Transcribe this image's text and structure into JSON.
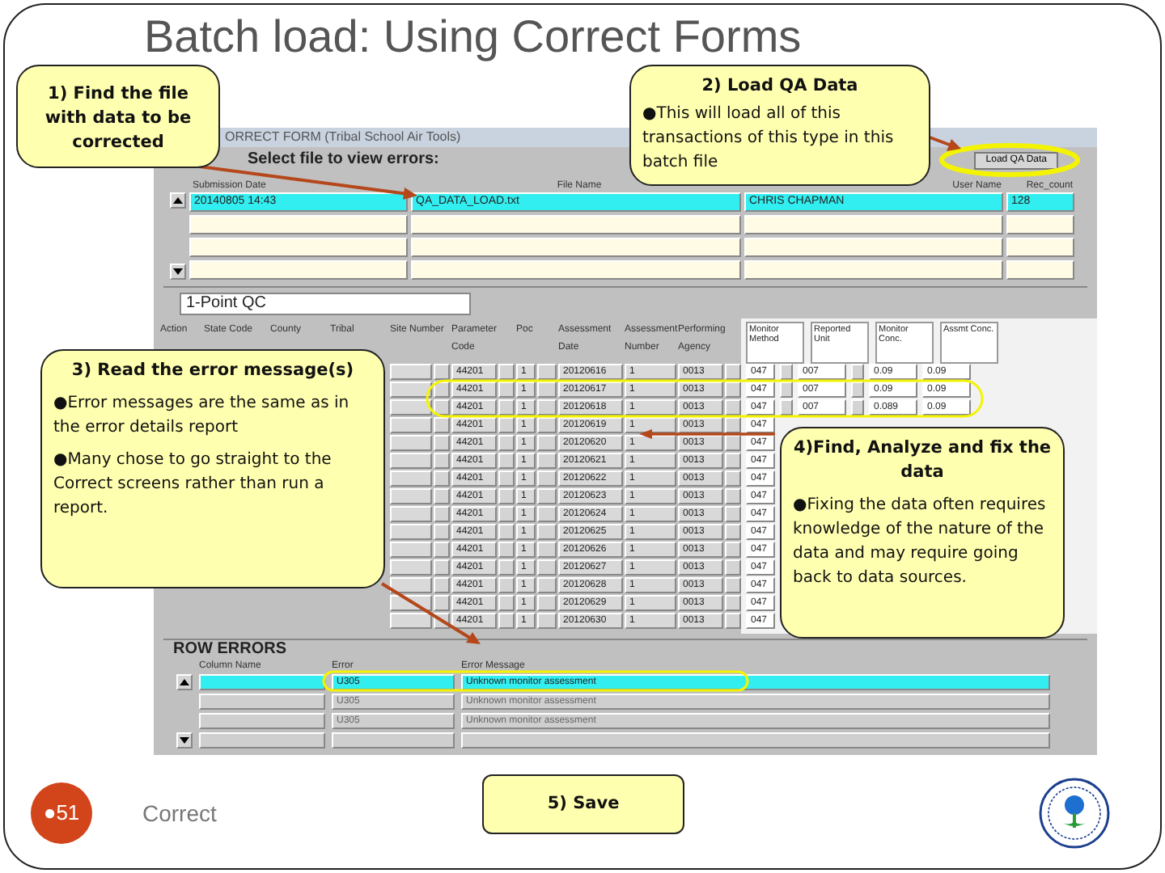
{
  "slide": {
    "title": "Batch load: Using Correct Forms",
    "footer_text": "Correct",
    "slide_number": "●51"
  },
  "form": {
    "title": "ORRECT FORM (Tribal School Air Tools)",
    "file_prompt": "Select file to view errors:",
    "load_button": "Load QA Data",
    "file_columns": [
      "Submission Date",
      "File Name",
      "User Name",
      "Rec_count"
    ],
    "files": [
      {
        "selected": true,
        "date": "20140805 14:43",
        "file": "QA_DATA_LOAD.txt",
        "user": "CHRIS CHAPMAN",
        "count": "128"
      },
      {
        "selected": false
      },
      {
        "selected": false
      },
      {
        "selected": false
      }
    ],
    "transaction_type": "1-Point QC",
    "qc_columns": [
      "Action",
      "State Code",
      "County",
      "Tribal",
      "Site Number",
      "Parameter Code",
      "Poc",
      "Assessment Date",
      "Assessment Number",
      "Performing Agency"
    ],
    "qc_rows": [
      {
        "cells": [
          "44201",
          "1",
          "20120616",
          "1",
          "0013"
        ]
      },
      {
        "cells": [
          "44201",
          "1",
          "20120617",
          "1",
          "0013"
        ]
      },
      {
        "cells": [
          "44201",
          "1",
          "20120618",
          "1",
          "0013"
        ]
      },
      {
        "cells": [
          "44201",
          "1",
          "20120619",
          "1",
          "0013"
        ]
      },
      {
        "cells": [
          "44201",
          "1",
          "20120620",
          "1",
          "0013"
        ]
      },
      {
        "cells": [
          "44201",
          "1",
          "20120621",
          "1",
          "0013"
        ]
      },
      {
        "cells": [
          "44201",
          "1",
          "20120622",
          "1",
          "0013"
        ]
      },
      {
        "cells": [
          "44201",
          "1",
          "20120623",
          "1",
          "0013"
        ]
      },
      {
        "cells": [
          "44201",
          "1",
          "20120624",
          "1",
          "0013"
        ]
      },
      {
        "cells": [
          "44201",
          "1",
          "20120625",
          "1",
          "0013"
        ]
      },
      {
        "cells": [
          "44201",
          "1",
          "20120626",
          "1",
          "0013"
        ]
      },
      {
        "cells": [
          "44201",
          "1",
          "20120627",
          "1",
          "0013"
        ]
      },
      {
        "cells": [
          "44201",
          "1",
          "20120628",
          "1",
          "0013"
        ]
      },
      {
        "cells": [
          "44201",
          "1",
          "20120629",
          "1",
          "0013"
        ]
      },
      {
        "cells": [
          "44201",
          "1",
          "20120630",
          "1",
          "0013"
        ]
      }
    ],
    "monitor_columns": [
      "Monitor Method",
      "Reported Unit",
      "Monitor Conc.",
      "Assmt Conc."
    ],
    "monitor_rows": [
      {
        "cells": [
          "047",
          "007",
          "0.09",
          "0.09"
        ]
      },
      {
        "cells": [
          "047",
          "007",
          "0.09",
          "0.09"
        ]
      },
      {
        "cells": [
          "047",
          "007",
          "0.089",
          "0.09"
        ]
      },
      {
        "cells": [
          "047"
        ]
      },
      {
        "cells": [
          "047"
        ]
      },
      {
        "cells": [
          "047"
        ]
      },
      {
        "cells": [
          "047"
        ]
      },
      {
        "cells": [
          "047"
        ]
      },
      {
        "cells": [
          "047"
        ]
      },
      {
        "cells": [
          "047"
        ]
      },
      {
        "cells": [
          "047"
        ]
      },
      {
        "cells": [
          "047"
        ]
      },
      {
        "cells": [
          "047"
        ]
      },
      {
        "cells": [
          "047"
        ]
      },
      {
        "cells": [
          "047"
        ]
      }
    ],
    "errors_title": "ROW ERRORS",
    "error_columns": [
      "Column Name",
      "Error",
      "Error Message"
    ],
    "errors": [
      {
        "selected": true,
        "error": "U305",
        "message": "Unknown monitor assessment"
      },
      {
        "selected": false,
        "error": "U305",
        "message": "Unknown monitor assessment"
      },
      {
        "selected": false,
        "error": "U305",
        "message": "Unknown monitor assessment"
      },
      {
        "selected": false
      }
    ]
  },
  "callouts": [
    {
      "heading": "1) Find the file with data to be corrected"
    },
    {
      "heading": "2) Load QA Data",
      "bullets": [
        "●This will load all of this transactions of this type in this batch file"
      ]
    },
    {
      "heading": "3) Read the error message(s)",
      "bullets": [
        "●Error messages are the same as in the error details report",
        "●Many chose to go straight to the Correct screens rather than run a report."
      ]
    },
    {
      "heading": "4)Find, Analyze and fix the data",
      "bullets": [
        "●Fixing the data often requires knowledge of the nature of the data and may require going back to data sources."
      ]
    },
    {
      "heading": "5) Save"
    }
  ]
}
